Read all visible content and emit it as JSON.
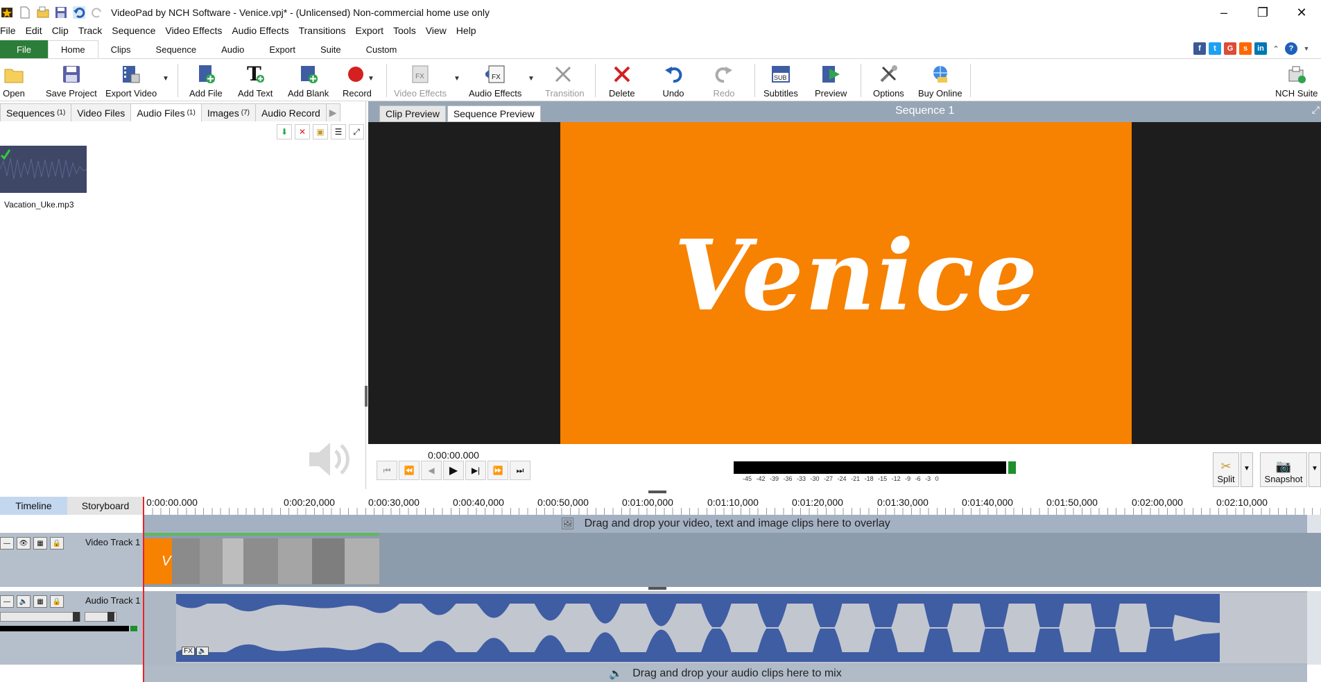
{
  "window": {
    "title": "VideoPad by NCH Software - Venice.vpj* - (Unlicensed) Non-commercial home use only",
    "minimize": "–",
    "restore": "❐",
    "close": "✕"
  },
  "menu": [
    "File",
    "Edit",
    "Clip",
    "Track",
    "Sequence",
    "Video Effects",
    "Audio Effects",
    "Transitions",
    "Export",
    "Tools",
    "View",
    "Help"
  ],
  "ribbon_tabs": [
    "File",
    "Home",
    "Clips",
    "Sequence",
    "Audio",
    "Export",
    "Suite",
    "Custom"
  ],
  "toolbar": {
    "open": "Open",
    "save_project": "Save Project",
    "export_video": "Export Video",
    "add_file": "Add File",
    "add_text": "Add Text",
    "add_blank": "Add Blank",
    "record": "Record",
    "video_effects": "Video Effects",
    "audio_effects": "Audio Effects",
    "transition": "Transition",
    "delete": "Delete",
    "undo": "Undo",
    "redo": "Redo",
    "subtitles": "Subtitles",
    "preview": "Preview",
    "options": "Options",
    "buy_online": "Buy Online",
    "nch_suite": "NCH Suite"
  },
  "media_tabs": {
    "sequences": "Sequences",
    "sequences_count": "(1)",
    "video_files": "Video Files",
    "audio_files": "Audio Files",
    "audio_files_count": "(1)",
    "images": "Images",
    "images_count": "(7)",
    "audio_record": "Audio Record"
  },
  "media_item": {
    "name": "Vacation_Uke.mp3"
  },
  "preview": {
    "clip_tab": "Clip Preview",
    "sequence_tab": "Sequence Preview",
    "sequence_title": "Sequence 1",
    "video_text": "Venice",
    "timecode": "0:00:00.000",
    "meter_scale": "-45 -42 -39 -36 -33 -30 -27 -24 -21 -18 -15 -12 -9 -6 -3 0",
    "split": "Split",
    "snapshot": "Snapshot"
  },
  "timeline": {
    "timeline_tab": "Timeline",
    "storyboard_tab": "Storyboard",
    "ruler": [
      "0:00:00.000",
      "0:00:20,000",
      "0:00:30,000",
      "0:00:40,000",
      "0:00:50,000",
      "0:01:00,000",
      "0:01:10,000",
      "0:01:20,000",
      "0:01:30,000",
      "0:01:40,000",
      "0:01:50,000",
      "0:02:00,000",
      "0:02:10,000"
    ],
    "overlay_hint": "Drag and drop your video, text and image clips here to overlay",
    "video_track": "Video Track 1",
    "audio_track": "Audio Track 1",
    "audio_hint": "Drag and drop your audio clips here to mix",
    "fx_label": "FX"
  },
  "colors": {
    "accent_green": "#2d7d3a",
    "preview_orange": "#f78100",
    "track_blue": "#8c9cad",
    "wave_blue": "#3f5da3"
  }
}
